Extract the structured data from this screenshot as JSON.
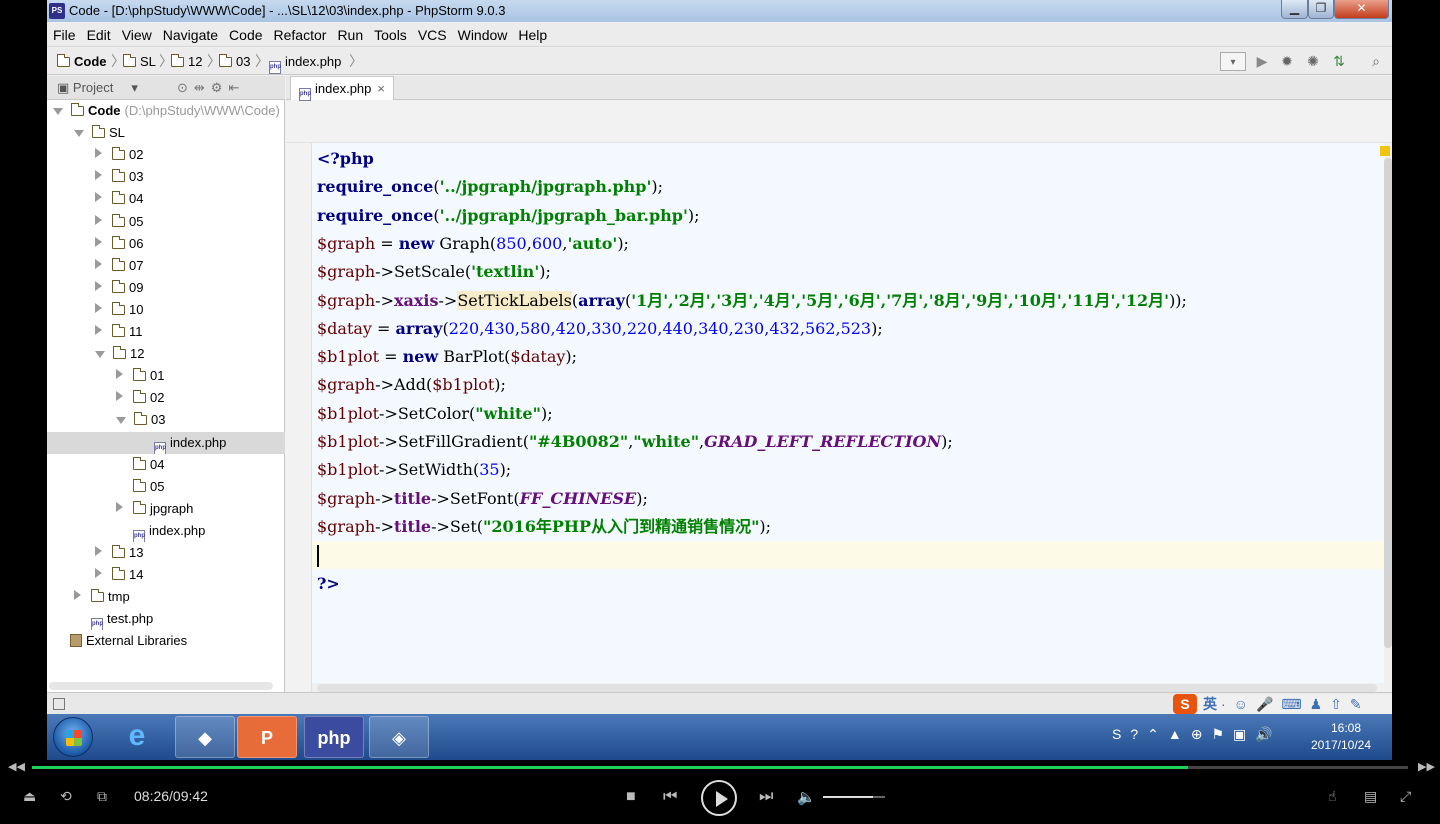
{
  "window": {
    "title": "Code - [D:\\phpStudy\\WWW\\Code] - ...\\SL\\12\\03\\index.php - PhpStorm 9.0.3"
  },
  "menu": [
    "File",
    "Edit",
    "View",
    "Navigate",
    "Code",
    "Refactor",
    "Run",
    "Tools",
    "VCS",
    "Window",
    "Help"
  ],
  "breadcrumb": [
    "Code",
    "SL",
    "12",
    "03",
    "index.php"
  ],
  "project_panel": {
    "title": "Project",
    "tree": [
      {
        "label": "Code",
        "extra": "(D:\\phpStudy\\WWW\\Code)",
        "level": 0,
        "state": "open",
        "icon": "folder-icon"
      },
      {
        "label": "SL",
        "level": 1,
        "state": "open",
        "icon": "folder-icon"
      },
      {
        "label": "02",
        "level": 2,
        "state": "closed",
        "icon": "folder-icon"
      },
      {
        "label": "03",
        "level": 2,
        "state": "closed",
        "icon": "folder-icon"
      },
      {
        "label": "04",
        "level": 2,
        "state": "closed",
        "icon": "folder-icon"
      },
      {
        "label": "05",
        "level": 2,
        "state": "closed",
        "icon": "folder-icon"
      },
      {
        "label": "06",
        "level": 2,
        "state": "closed",
        "icon": "folder-icon"
      },
      {
        "label": "07",
        "level": 2,
        "state": "closed",
        "icon": "folder-icon"
      },
      {
        "label": "09",
        "level": 2,
        "state": "closed",
        "icon": "folder-icon"
      },
      {
        "label": "10",
        "level": 2,
        "state": "closed",
        "icon": "folder-icon"
      },
      {
        "label": "11",
        "level": 2,
        "state": "closed",
        "icon": "folder-icon"
      },
      {
        "label": "12",
        "level": 2,
        "state": "open",
        "icon": "folder-icon"
      },
      {
        "label": "01",
        "level": 3,
        "state": "closed",
        "icon": "folder-icon"
      },
      {
        "label": "02",
        "level": 3,
        "state": "closed",
        "icon": "folder-icon"
      },
      {
        "label": "03",
        "level": 3,
        "state": "open",
        "icon": "folder-icon"
      },
      {
        "label": "index.php",
        "level": 4,
        "state": "file",
        "icon": "php-file-icon",
        "selected": true
      },
      {
        "label": "04",
        "level": 3,
        "state": "leaf",
        "icon": "folder-icon"
      },
      {
        "label": "05",
        "level": 3,
        "state": "leaf",
        "icon": "folder-icon"
      },
      {
        "label": "jpgraph",
        "level": 3,
        "state": "closed",
        "icon": "folder-icon"
      },
      {
        "label": "index.php",
        "level": 3,
        "state": "file",
        "icon": "php-file-icon"
      },
      {
        "label": "13",
        "level": 2,
        "state": "closed",
        "icon": "folder-icon"
      },
      {
        "label": "14",
        "level": 2,
        "state": "closed",
        "icon": "folder-icon"
      },
      {
        "label": "tmp",
        "level": 1,
        "state": "closed",
        "icon": "folder-icon"
      },
      {
        "label": "test.php",
        "level": 1,
        "state": "file",
        "icon": "php-file-icon"
      },
      {
        "label": "External Libraries",
        "level": 0,
        "state": "file",
        "icon": "library-icon"
      }
    ]
  },
  "editor": {
    "tab": "index.php",
    "lines": [
      [
        [
          "kw",
          "<?php"
        ]
      ],
      [
        [
          "kw",
          "require_once"
        ],
        [
          "",
          "("
        ],
        [
          "str",
          "'../jpgraph/jpgraph.php'"
        ],
        [
          "",
          ");"
        ]
      ],
      [
        [
          "kw",
          "require_once"
        ],
        [
          "",
          "("
        ],
        [
          "str",
          "'../jpgraph/jpgraph_bar.php'"
        ],
        [
          "",
          ");"
        ]
      ],
      [
        [
          "var",
          "$graph"
        ],
        [
          "",
          " = "
        ],
        [
          "kw",
          "new"
        ],
        [
          "",
          " Graph("
        ],
        [
          "num",
          "850"
        ],
        [
          "",
          ","
        ],
        [
          "num",
          "600"
        ],
        [
          "",
          ","
        ],
        [
          "str",
          "'auto'"
        ],
        [
          "",
          ");"
        ]
      ],
      [
        [
          "var",
          "$graph"
        ],
        [
          "",
          "->SetScale("
        ],
        [
          "str",
          "'textlin'"
        ],
        [
          "",
          ");"
        ]
      ],
      [
        [
          "var",
          "$graph"
        ],
        [
          "",
          "->"
        ],
        [
          "prop",
          "xaxis"
        ],
        [
          "",
          "->"
        ],
        [
          "hl",
          "SetTickLabels"
        ],
        [
          "",
          "("
        ],
        [
          "kw",
          "array"
        ],
        [
          "",
          "("
        ],
        [
          "str",
          "'1月','2月','3月','4月','5月','6月','7月','8月','9月','10月','11月','12月'"
        ],
        [
          "",
          "));"
        ]
      ],
      [
        [
          "var",
          "$datay"
        ],
        [
          "",
          " = "
        ],
        [
          "kw",
          "array"
        ],
        [
          "",
          "("
        ],
        [
          "num",
          "220,430,580,420,330,220,440,340,230,432,562,523"
        ],
        [
          "",
          ");"
        ]
      ],
      [
        [
          "var",
          "$b1plot"
        ],
        [
          "",
          " = "
        ],
        [
          "kw",
          "new"
        ],
        [
          "",
          " BarPlot("
        ],
        [
          "var",
          "$datay"
        ],
        [
          "",
          ");"
        ]
      ],
      [
        [
          "var",
          "$graph"
        ],
        [
          "",
          "->Add("
        ],
        [
          "var",
          "$b1plot"
        ],
        [
          "",
          ");"
        ]
      ],
      [
        [
          "var",
          "$b1plot"
        ],
        [
          "",
          "->SetColor("
        ],
        [
          "str",
          "\"white\""
        ],
        [
          "",
          ");"
        ]
      ],
      [
        [
          "var",
          "$b1plot"
        ],
        [
          "",
          "->SetFillGradient("
        ],
        [
          "str",
          "\"#4B0082\""
        ],
        [
          "",
          ","
        ],
        [
          "str",
          "\"white\""
        ],
        [
          "",
          ","
        ],
        [
          "const",
          "GRAD_LEFT_REFLECTION"
        ],
        [
          "",
          ");"
        ]
      ],
      [
        [
          "var",
          "$b1plot"
        ],
        [
          "",
          "->SetWidth("
        ],
        [
          "num",
          "35"
        ],
        [
          "",
          ");"
        ]
      ],
      [
        [
          "var",
          "$graph"
        ],
        [
          "",
          "->"
        ],
        [
          "prop",
          "title"
        ],
        [
          "",
          "->SetFont("
        ],
        [
          "const",
          "FF_CHINESE"
        ],
        [
          "",
          ");"
        ]
      ],
      [
        [
          "var",
          "$graph"
        ],
        [
          "",
          "->"
        ],
        [
          "prop",
          "title"
        ],
        [
          "",
          "->Set("
        ],
        [
          "str",
          "\"2016年PHP从入门到精通销售情况\""
        ],
        [
          "",
          ");"
        ]
      ],
      [],
      [
        [
          "kw",
          "?>"
        ]
      ]
    ]
  },
  "ime": {
    "logo": "S",
    "lang": "英"
  },
  "taskbar": {
    "time": "16:08",
    "date": "2017/10/24",
    "apps": [
      "internet-explorer-icon",
      "app-icon",
      "powerpoint-icon",
      "phpstorm-icon",
      "app-icon-2"
    ]
  },
  "player": {
    "time": "08:26/09:42",
    "progress": 0.84,
    "volume": 0.8,
    "accent": "#1ed05c"
  }
}
